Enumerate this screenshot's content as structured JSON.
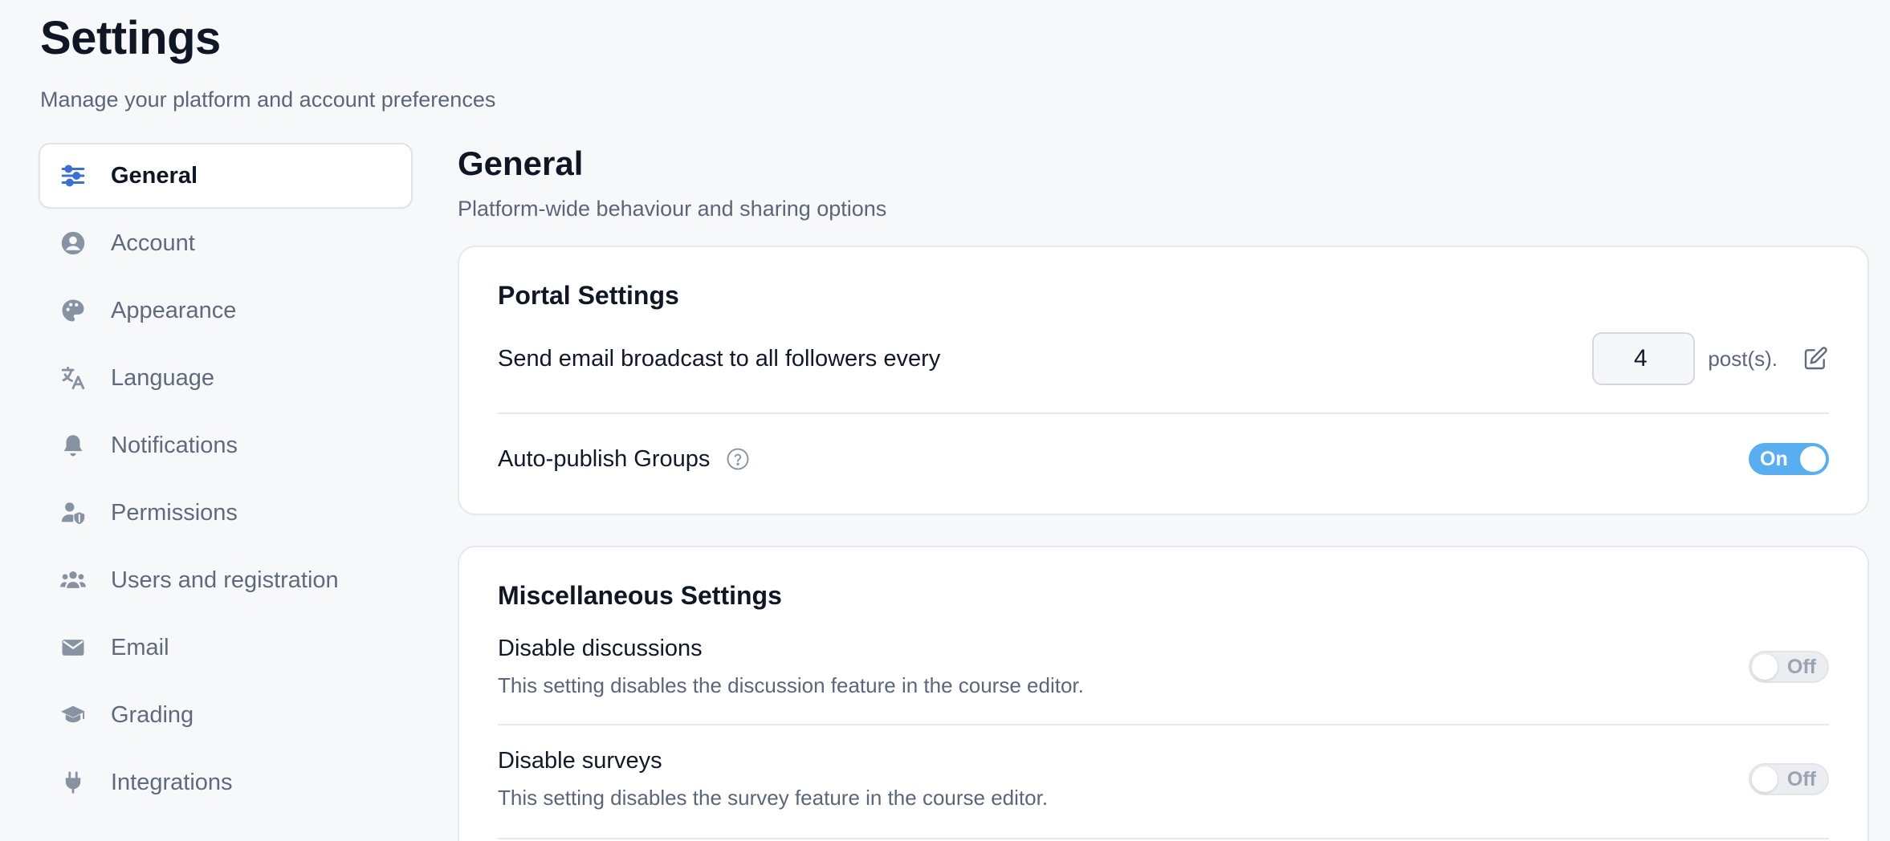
{
  "header": {
    "title": "Settings",
    "subtitle": "Manage your platform and account preferences"
  },
  "sidebar": {
    "items": [
      {
        "label": "General",
        "icon": "sliders-icon",
        "active": true
      },
      {
        "label": "Account",
        "icon": "user-circle-icon"
      },
      {
        "label": "Appearance",
        "icon": "palette-icon"
      },
      {
        "label": "Language",
        "icon": "translate-icon"
      },
      {
        "label": "Notifications",
        "icon": "bell-icon"
      },
      {
        "label": "Permissions",
        "icon": "user-shield-icon"
      },
      {
        "label": "Users and registration",
        "icon": "users-icon"
      },
      {
        "label": "Email",
        "icon": "envelope-icon"
      },
      {
        "label": "Grading",
        "icon": "graduation-cap-icon"
      },
      {
        "label": "Integrations",
        "icon": "plug-icon"
      }
    ]
  },
  "main": {
    "title": "General",
    "subtitle": "Platform-wide behaviour and sharing options",
    "portal": {
      "title": "Portal Settings",
      "broadcast": {
        "label": "Send email broadcast to all followers every",
        "value": "4",
        "unit": "post(s)."
      },
      "auto_publish": {
        "label": "Auto-publish Groups",
        "toggle": "On"
      }
    },
    "misc": {
      "title": "Miscellaneous Settings",
      "discussions": {
        "label": "Disable discussions",
        "description": "This setting disables the discussion feature in the course editor.",
        "toggle": "Off"
      },
      "surveys": {
        "label": "Disable surveys",
        "description": "This setting disables the survey feature in the course editor.",
        "toggle": "Off"
      }
    }
  },
  "colors": {
    "accent": "#3b6fd4",
    "toggle_on": "#5aaef0",
    "toggle_off": "#ebedf1"
  }
}
